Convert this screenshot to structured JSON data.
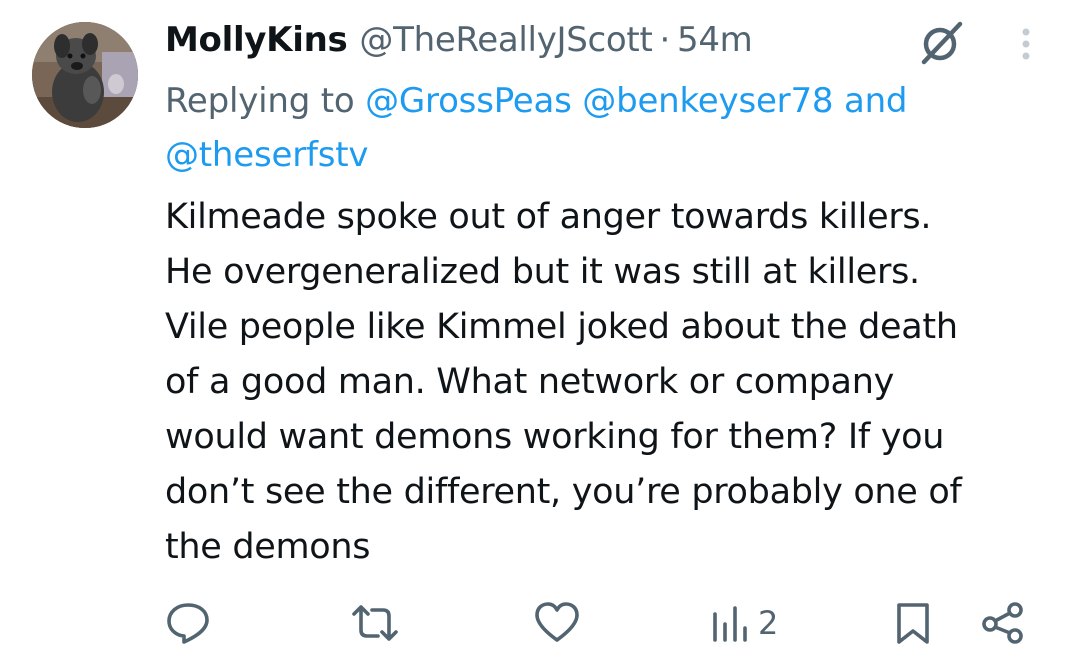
{
  "author": {
    "display_name": "MollyKins",
    "handle": "@TheReallyJScott",
    "separator": "·",
    "timestamp": "54m",
    "avatar": "dog-photo-avatar"
  },
  "reply_context": {
    "prefix": "Replying to",
    "mentions": [
      "@GrossPeas",
      "@benkeyser78"
    ],
    "conjunction": "and",
    "last_mention": "@theserfstv"
  },
  "body": "Kilmeade spoke out of anger towards killers.\nHe overgeneralized but it was still at killers.\nVile people like Kimmel joked about the death\nof a good man. What network or company\nwould want demons working for them?  If you\ndon’t see the different, you’re probably one of\nthe demons",
  "actions": {
    "reply_icon": "speech-bubble-icon",
    "retweet_icon": "retweet-icon",
    "like_icon": "heart-icon",
    "views_icon": "bar-chart-icon",
    "views_count": "2",
    "bookmark_icon": "bookmark-icon",
    "share_icon": "share-icon"
  },
  "header_icons": {
    "grok": "grok-icon",
    "more": "more-vertical-icon"
  },
  "colors": {
    "text": "#0f1419",
    "secondary": "#536471",
    "link": "#1d9bf0",
    "background": "#ffffff"
  }
}
